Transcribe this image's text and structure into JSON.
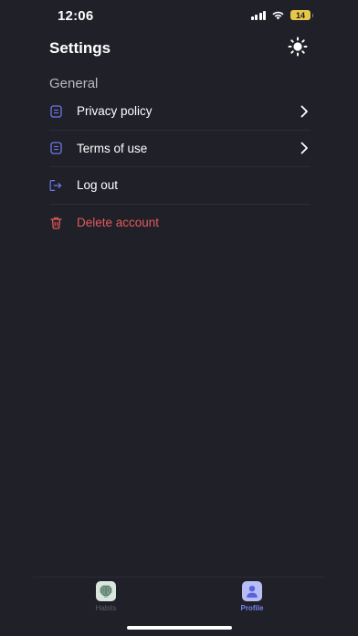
{
  "status_bar": {
    "time": "12:06",
    "battery_level": "14",
    "icons": [
      "signal-icon",
      "wifi-icon",
      "battery-icon"
    ]
  },
  "header": {
    "title": "Settings",
    "theme_icon": "sun-icon"
  },
  "sections": [
    {
      "title": "General",
      "items": [
        {
          "label": "Privacy policy",
          "icon": "document-icon",
          "has_chevron": true
        },
        {
          "label": "Terms of use",
          "icon": "document-icon",
          "has_chevron": true
        },
        {
          "label": "Log out",
          "icon": "logout-icon",
          "has_chevron": false
        },
        {
          "label": "Delete account",
          "icon": "trash-icon",
          "has_chevron": false,
          "destructive": true
        }
      ]
    }
  ],
  "tab_bar": {
    "tabs": [
      {
        "label": "Habits",
        "icon": "brain-icon",
        "active": false
      },
      {
        "label": "Profile",
        "icon": "user-icon",
        "active": true
      }
    ]
  },
  "colors": {
    "background": "#1f2028",
    "accent": "#7b83ee",
    "danger": "#e45a5a",
    "divider": "#2c2d37"
  }
}
